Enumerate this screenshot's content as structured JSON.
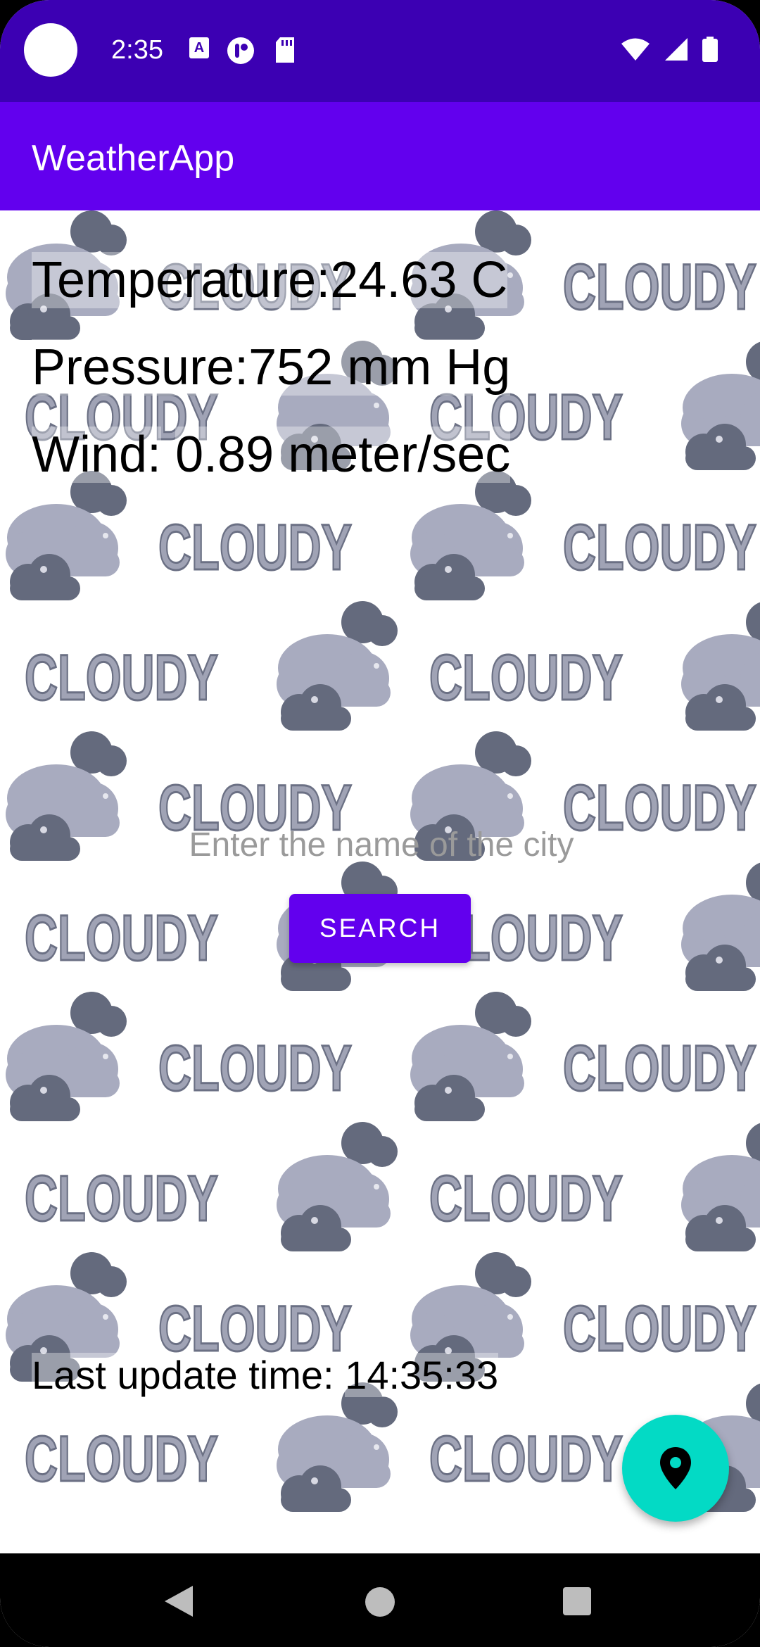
{
  "status_bar": {
    "time": "2:35",
    "icons": [
      "text-a-icon",
      "sync-icon",
      "sd-card-icon",
      "wifi-icon",
      "signal-icon",
      "battery-icon"
    ]
  },
  "app_bar": {
    "title": "WeatherApp"
  },
  "weather": {
    "temperature_label": "Temperature:",
    "temperature_value": "24.63 C",
    "pressure_label": "Pressure:",
    "pressure_value": "752 mm Hg",
    "wind_label": "Wind:",
    "wind_value": "0.89 meter/sec"
  },
  "background": {
    "pattern_text": "CLOUDY",
    "icon": "cloud-icon"
  },
  "search": {
    "placeholder": "Enter the name of the city",
    "button_label": "SEARCH"
  },
  "footer": {
    "last_update_label": "Last update time:",
    "last_update_value": "14:35:33"
  },
  "fab": {
    "icon": "location-pin-icon"
  },
  "nav_bar": {
    "buttons": [
      "back-icon",
      "home-icon",
      "recents-icon"
    ]
  },
  "colors": {
    "status_bar": "#3c00b3",
    "app_bar": "#6200ee",
    "button": "#6200ee",
    "fab": "#03dac5",
    "cloud_light": "#a8abbf",
    "cloud_dark": "#646a7d"
  }
}
